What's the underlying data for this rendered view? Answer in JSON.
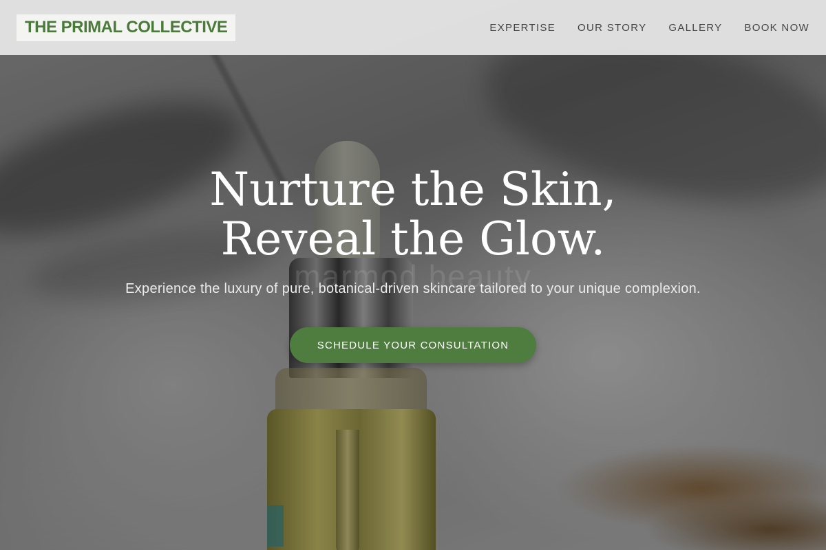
{
  "brand": {
    "name": "THE PRIMAL COLLECTIVE",
    "accent_color": "#4f7d3f"
  },
  "nav": {
    "items": [
      {
        "label": "EXPERTISE"
      },
      {
        "label": "OUR STORY"
      },
      {
        "label": "GALLERY"
      },
      {
        "label": "BOOK NOW"
      }
    ]
  },
  "hero": {
    "headline_line1": "Nurture the Skin,",
    "headline_line2": "Reveal the Glow.",
    "subtext": "Experience the luxury of pure, botanical-driven skincare tailored to your unique complexion.",
    "cta_label": "SCHEDULE YOUR CONSULTATION",
    "watermark": "marmod beauty"
  }
}
